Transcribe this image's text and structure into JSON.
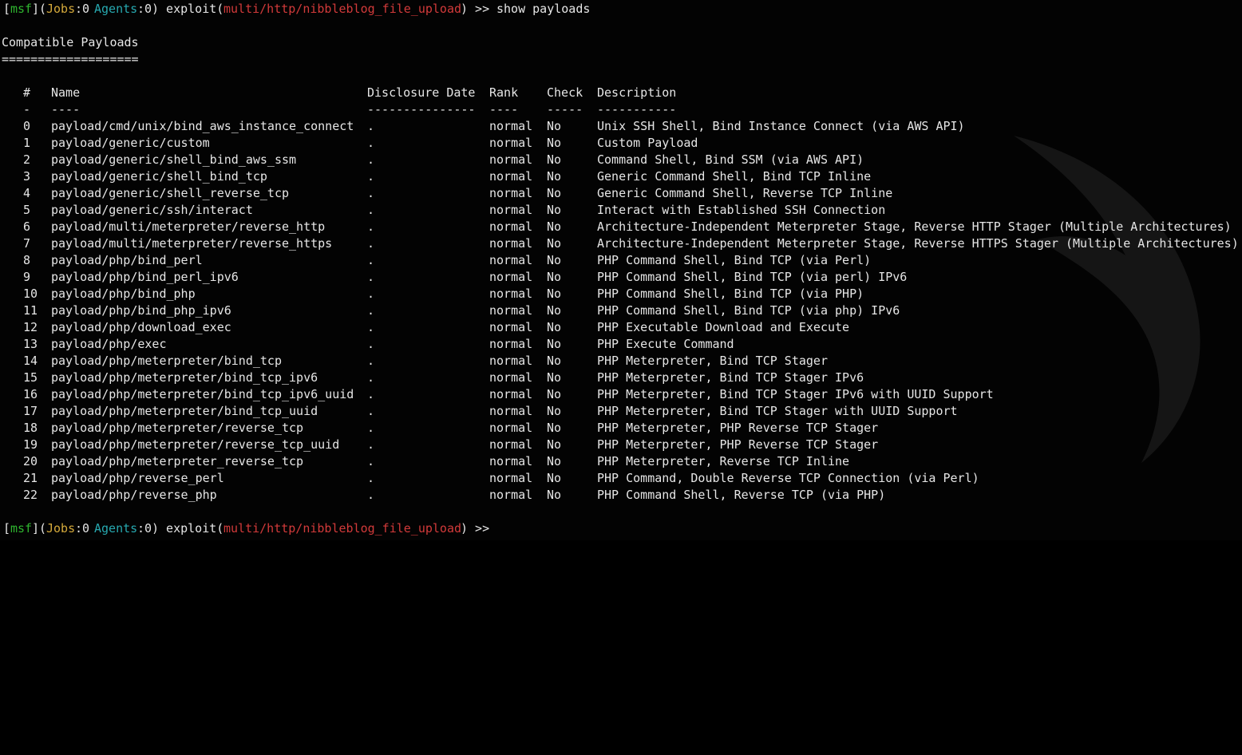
{
  "prompt": {
    "open_bracket": "[",
    "msf": "msf",
    "close_paren_open": "](",
    "jobs_label": "Jobs",
    "colon1": ":",
    "jobs_count": "0",
    "agents_label": "Agents",
    "colon2": ":",
    "agents_count": "0",
    "exploit_prefix": ") exploit(",
    "module": "multi/http/nibbleblog_file_upload",
    "suffix": ") >>"
  },
  "command": "show payloads",
  "section_title": "Compatible Payloads",
  "section_underline": "===================",
  "columns": {
    "num": "#",
    "name": "Name",
    "date": "Disclosure Date",
    "rank": "Rank",
    "check": "Check",
    "desc": "Description"
  },
  "column_underlines": {
    "num": "-",
    "name": "----",
    "date": "---------------",
    "rank": "----",
    "check": "-----",
    "desc": "-----------"
  },
  "rows": [
    {
      "num": "0",
      "name": "payload/cmd/unix/bind_aws_instance_connect",
      "date": ".",
      "rank": "normal",
      "check": "No",
      "desc": "Unix SSH Shell, Bind Instance Connect (via AWS API)"
    },
    {
      "num": "1",
      "name": "payload/generic/custom",
      "date": ".",
      "rank": "normal",
      "check": "No",
      "desc": "Custom Payload"
    },
    {
      "num": "2",
      "name": "payload/generic/shell_bind_aws_ssm",
      "date": ".",
      "rank": "normal",
      "check": "No",
      "desc": "Command Shell, Bind SSM (via AWS API)"
    },
    {
      "num": "3",
      "name": "payload/generic/shell_bind_tcp",
      "date": ".",
      "rank": "normal",
      "check": "No",
      "desc": "Generic Command Shell, Bind TCP Inline"
    },
    {
      "num": "4",
      "name": "payload/generic/shell_reverse_tcp",
      "date": ".",
      "rank": "normal",
      "check": "No",
      "desc": "Generic Command Shell, Reverse TCP Inline"
    },
    {
      "num": "5",
      "name": "payload/generic/ssh/interact",
      "date": ".",
      "rank": "normal",
      "check": "No",
      "desc": "Interact with Established SSH Connection"
    },
    {
      "num": "6",
      "name": "payload/multi/meterpreter/reverse_http",
      "date": ".",
      "rank": "normal",
      "check": "No",
      "desc": "Architecture-Independent Meterpreter Stage, Reverse HTTP Stager (Multiple Architectures)"
    },
    {
      "num": "7",
      "name": "payload/multi/meterpreter/reverse_https",
      "date": ".",
      "rank": "normal",
      "check": "No",
      "desc": "Architecture-Independent Meterpreter Stage, Reverse HTTPS Stager (Multiple Architectures)"
    },
    {
      "num": "8",
      "name": "payload/php/bind_perl",
      "date": ".",
      "rank": "normal",
      "check": "No",
      "desc": "PHP Command Shell, Bind TCP (via Perl)"
    },
    {
      "num": "9",
      "name": "payload/php/bind_perl_ipv6",
      "date": ".",
      "rank": "normal",
      "check": "No",
      "desc": "PHP Command Shell, Bind TCP (via perl) IPv6"
    },
    {
      "num": "10",
      "name": "payload/php/bind_php",
      "date": ".",
      "rank": "normal",
      "check": "No",
      "desc": "PHP Command Shell, Bind TCP (via PHP)"
    },
    {
      "num": "11",
      "name": "payload/php/bind_php_ipv6",
      "date": ".",
      "rank": "normal",
      "check": "No",
      "desc": "PHP Command Shell, Bind TCP (via php) IPv6"
    },
    {
      "num": "12",
      "name": "payload/php/download_exec",
      "date": ".",
      "rank": "normal",
      "check": "No",
      "desc": "PHP Executable Download and Execute"
    },
    {
      "num": "13",
      "name": "payload/php/exec",
      "date": ".",
      "rank": "normal",
      "check": "No",
      "desc": "PHP Execute Command"
    },
    {
      "num": "14",
      "name": "payload/php/meterpreter/bind_tcp",
      "date": ".",
      "rank": "normal",
      "check": "No",
      "desc": "PHP Meterpreter, Bind TCP Stager"
    },
    {
      "num": "15",
      "name": "payload/php/meterpreter/bind_tcp_ipv6",
      "date": ".",
      "rank": "normal",
      "check": "No",
      "desc": "PHP Meterpreter, Bind TCP Stager IPv6"
    },
    {
      "num": "16",
      "name": "payload/php/meterpreter/bind_tcp_ipv6_uuid",
      "date": ".",
      "rank": "normal",
      "check": "No",
      "desc": "PHP Meterpreter, Bind TCP Stager IPv6 with UUID Support"
    },
    {
      "num": "17",
      "name": "payload/php/meterpreter/bind_tcp_uuid",
      "date": ".",
      "rank": "normal",
      "check": "No",
      "desc": "PHP Meterpreter, Bind TCP Stager with UUID Support"
    },
    {
      "num": "18",
      "name": "payload/php/meterpreter/reverse_tcp",
      "date": ".",
      "rank": "normal",
      "check": "No",
      "desc": "PHP Meterpreter, PHP Reverse TCP Stager"
    },
    {
      "num": "19",
      "name": "payload/php/meterpreter/reverse_tcp_uuid",
      "date": ".",
      "rank": "normal",
      "check": "No",
      "desc": "PHP Meterpreter, PHP Reverse TCP Stager"
    },
    {
      "num": "20",
      "name": "payload/php/meterpreter_reverse_tcp",
      "date": ".",
      "rank": "normal",
      "check": "No",
      "desc": "PHP Meterpreter, Reverse TCP Inline"
    },
    {
      "num": "21",
      "name": "payload/php/reverse_perl",
      "date": ".",
      "rank": "normal",
      "check": "No",
      "desc": "PHP Command, Double Reverse TCP Connection (via Perl)"
    },
    {
      "num": "22",
      "name": "payload/php/reverse_php",
      "date": ".",
      "rank": "normal",
      "check": "No",
      "desc": "PHP Command Shell, Reverse TCP (via PHP)"
    }
  ],
  "colors": {
    "background": "#030303",
    "text": "#e6e6e6",
    "msf": "#2fb52f",
    "jobs": "#d4a93b",
    "agents": "#27a9b0",
    "module": "#d23a3a"
  }
}
